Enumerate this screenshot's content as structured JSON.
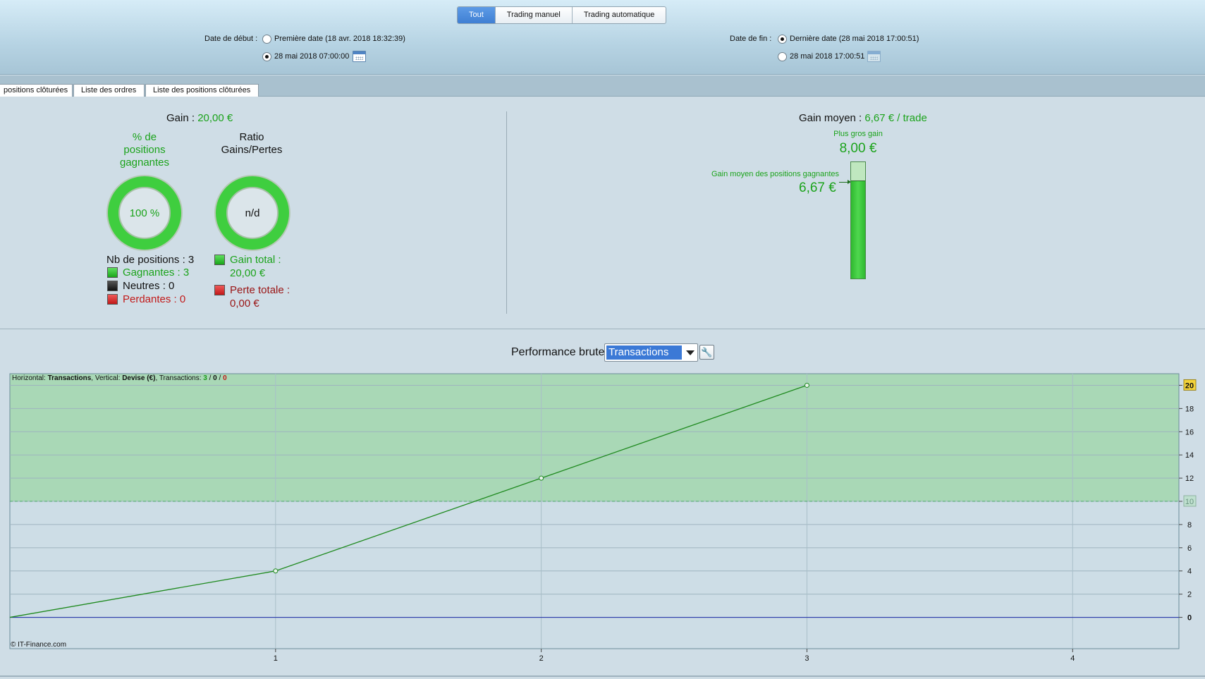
{
  "header": {
    "filter_tabs": [
      {
        "label": "Tout",
        "active": true
      },
      {
        "label": "Trading manuel",
        "active": false
      },
      {
        "label": "Trading automatique",
        "active": false
      }
    ],
    "start": {
      "label": "Date de début :",
      "option1": "Première date (18 avr. 2018 18:32:39)",
      "option2": "28 mai 2018 07:00:00",
      "selected": 2
    },
    "end": {
      "label": "Date de fin :",
      "option1": "Dernière date (28 mai 2018 17:00:51)",
      "option2": "28 mai 2018 17:00:51",
      "selected": 1
    }
  },
  "sub_tabs": [
    "positions clôturées",
    "Liste des ordres",
    "Liste des positions clôturées"
  ],
  "stats": {
    "gain_label": "Gain :",
    "gain_value": "20,00 €",
    "pct_title_lines": [
      "% de",
      "positions",
      "gagnantes"
    ],
    "pct_value": "100 %",
    "pct_fraction": 1.0,
    "ratio_title_lines": [
      "Ratio",
      "Gains/Pertes"
    ],
    "ratio_value": "n/d",
    "nb_positions": "Nb de positions : 3",
    "gagnantes": "Gagnantes : 3",
    "neutres": "Neutres : 0",
    "perdantes": "Perdantes : 0",
    "gain_total_label": "Gain total :",
    "gain_total_value": "20,00 €",
    "perte_totale_label": "Perte totale :",
    "perte_totale_value": "0,00 €",
    "gain_moyen_label": "Gain moyen :",
    "gain_moyen_value": "6,67 € / trade",
    "plus_gros_gain_label": "Plus gros gain",
    "plus_gros_gain_value": "8,00 €",
    "gain_moyen_gagnantes_label": "Gain moyen des positions gagnantes",
    "gain_moyen_gagnantes_value": "6,67 €",
    "bar_fraction": 0.834
  },
  "performance": {
    "label": "Performance brute",
    "select_value": "Transactions"
  },
  "chart_data": {
    "type": "line",
    "info_prefix_h": "Horizontal: ",
    "info_h_value": "Transactions",
    "info_prefix_v": ", Vertical: ",
    "info_v_value": "Devise (€)",
    "info_prefix_t": ", Transactions: ",
    "info_t1": "3",
    "info_sep": " / ",
    "info_t2": "0",
    "info_t3": "0",
    "copyright": "© IT-Finance.com",
    "x": [
      0,
      1,
      2,
      3
    ],
    "y": [
      0,
      4,
      12,
      20
    ],
    "xlim": [
      0,
      4.4
    ],
    "ylim": [
      -2.7,
      21
    ],
    "x_ticks": [
      "1",
      "2",
      "3",
      "4"
    ],
    "y_ticks": [
      "0",
      "2",
      "4",
      "6",
      "8",
      "10",
      "12",
      "14",
      "16",
      "18",
      "20"
    ],
    "average_line": 10,
    "highlight_tick": "20",
    "colors": {
      "line": "#1f8a1f",
      "above_fill": "#a9d8b6",
      "below_fill": "#cddde6",
      "zero_line": "#1a2aa8"
    }
  }
}
